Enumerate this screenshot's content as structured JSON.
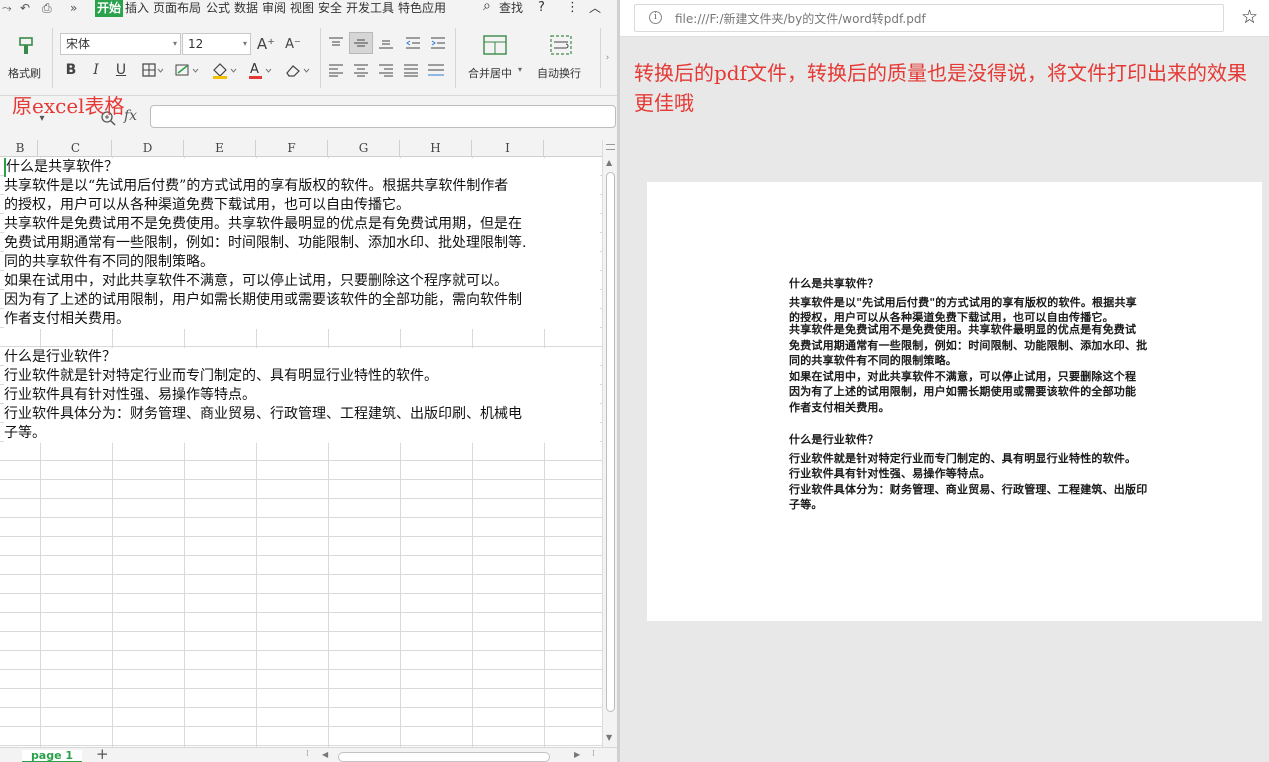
{
  "spreadsheet": {
    "menus": [
      "开始",
      "插入",
      "页面布局",
      "公式",
      "数据",
      "审阅",
      "视图",
      "安全",
      "开发工具",
      "特色应用"
    ],
    "search_label": "查找",
    "ribbon": {
      "format_painter": "格式刷",
      "font_name": "宋体",
      "font_size": "12",
      "merge_center": "合并居中",
      "wrap_text": "自动换行"
    },
    "overlay_note": "原excel表格",
    "fx_label": "fx",
    "columns": [
      "B",
      "C",
      "D",
      "E",
      "F",
      "G",
      "H",
      "I"
    ],
    "rows": [
      "什么是共享软件？",
      "共享软件是以“先试用后付费”的方式试用的享有版权的软件。根据共享软件制作者",
      "的授权，用户可以从各种渠道免费下载试用，也可以自由传播它。",
      "共享软件是免费试用不是免费使用。共享软件最明显的优点是有免费试用期，但是在",
      "免费试用期通常有一些限制，例如：时间限制、功能限制、添加水印、批处理限制等.",
      "同的共享软件有不同的限制策略。",
      "如果在试用中，对此共享软件不满意，可以停止试用，只要删除这个程序就可以。",
      "因为有了上述的试用限制，用户如需长期使用或需要该软件的全部功能，需向软件制",
      "作者支付相关费用。",
      "",
      "什么是行业软件？",
      "行业软件就是针对特定行业而专门制定的、具有明显行业特性的软件。",
      "行业软件具有针对性强、易操作等特点。",
      "行业软件具体分为：财务管理、商业贸易、行政管理、工程建筑、出版印刷、机械电",
      "子等。"
    ],
    "sheet_tab": "page 1",
    "add_sheet": "+"
  },
  "browser": {
    "url": "file:///F:/新建文件夹/by的文件/word转pdf.pdf",
    "overlay_note": "转换后的pdf文件，转换后的质量也是没得说，将文件打印出来的效果更佳哦",
    "pdf_lines": [
      "什么是共享软件？",
      "共享软件是以\"先试用后付费\"的方式试用的享有版权的软件。根据共享",
      "的授权，用户可以从各种渠道免费下载试用，也可以自由传播它。",
      "共享软件是免费试用不是免费使用。共享软件最明显的优点是有免费试",
      "免费试用期通常有一些限制，例如：时间限制、功能限制、添加水印、批",
      "同的共享软件有不同的限制策略。",
      "如果在试用中，对此共享软件不满意，可以停止试用，只要删除这个程",
      "因为有了上述的试用限制，用户如需长期使用或需要该软件的全部功能",
      "作者支付相关费用。",
      "",
      "什么是行业软件？",
      "行业软件就是针对特定行业而专门制定的、具有明显行业特性的软件。",
      "行业软件具有针对性强、易操作等特点。",
      "行业软件具体分为：财务管理、商业贸易、行政管理、工程建筑、出版印",
      "子等。"
    ]
  },
  "colors": {
    "accent_green": "#2aa14b",
    "annotation_red": "#e53935"
  }
}
